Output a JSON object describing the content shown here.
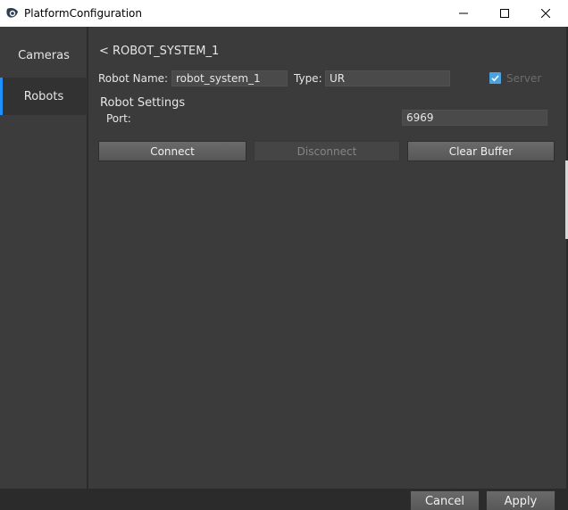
{
  "window": {
    "title": "PlatformConfiguration",
    "app_icon": "eye-icon",
    "minimize_icon": "minimize-icon",
    "maximize_icon": "maximize-icon",
    "close_icon": "close-icon"
  },
  "sidebar": {
    "items": [
      {
        "label": "Cameras",
        "active": false
      },
      {
        "label": "Robots",
        "active": true
      }
    ]
  },
  "robot": {
    "back_label": "< ROBOT_SYSTEM_1",
    "name_label": "Robot Name:",
    "name_value": "robot_system_1",
    "type_label": "Type:",
    "type_value": "UR",
    "server_label": "Server",
    "server_checked": true,
    "settings_title": "Robot Settings",
    "port_label": "Port:",
    "port_value": "6969"
  },
  "actions": {
    "connect": "Connect",
    "disconnect": "Disconnect",
    "clear_buffer": "Clear Buffer"
  },
  "footer": {
    "cancel": "Cancel",
    "apply": "Apply"
  },
  "colors": {
    "accent": "#1e90ff",
    "checkbox": "#4aa3df",
    "panel": "#3b3b3b",
    "sidebar": "#3c3c3c"
  }
}
